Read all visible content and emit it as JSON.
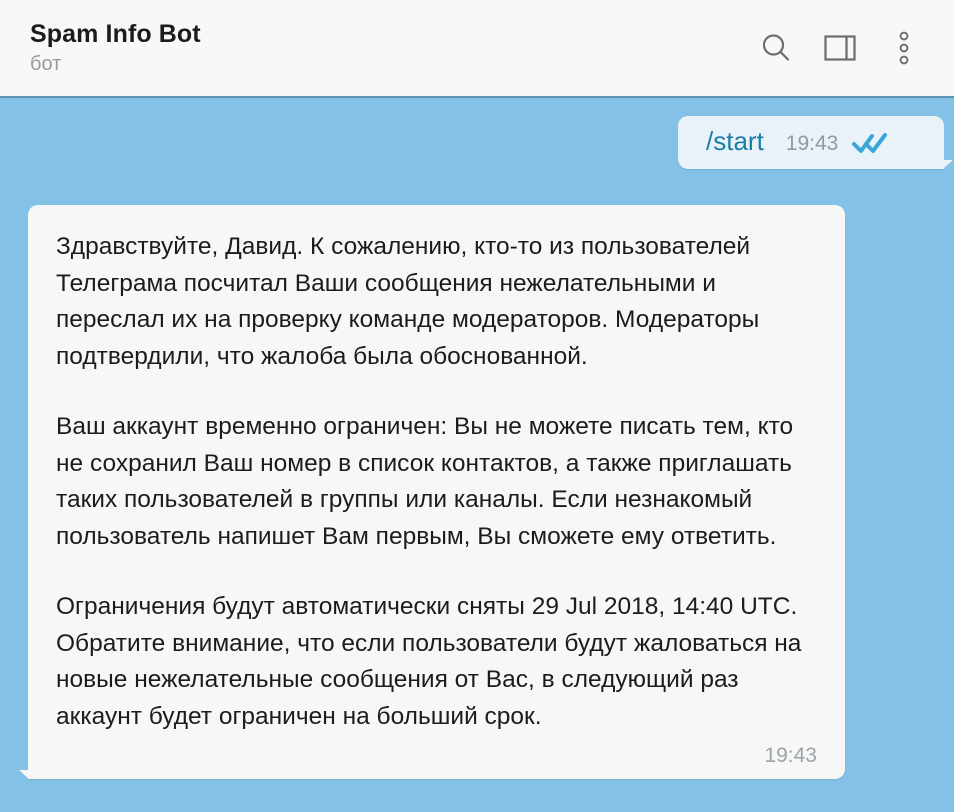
{
  "header": {
    "title": "Spam Info Bot",
    "subtitle": "бот",
    "actions": [
      {
        "name": "search-icon",
        "label": "Search"
      },
      {
        "name": "panel-toggle-icon",
        "label": "Toggle info panel"
      },
      {
        "name": "more-menu-icon",
        "label": "More options"
      }
    ]
  },
  "colors": {
    "chat_background": "#84c1e6",
    "header_background": "#f9f8f7",
    "incoming_bubble": "#f8f7f7",
    "outgoing_bubble": "#e8f2f8",
    "command_link": "#1c7da6",
    "tick_blue": "#3aa6db",
    "timestamp_gray": "#9aa3a8",
    "body_text": "#1c1c1c",
    "subtitle_gray": "#9a9a9a"
  },
  "messages": {
    "outgoing": {
      "text": "/start",
      "time": "19:43",
      "status": "read"
    },
    "incoming": {
      "paragraphs": [
        "Здравствуйте, Давид. К сожалению, кто-то из пользователей Телеграма посчитал Ваши сообщения нежелательными и переслал их на проверку команде модераторов. Модераторы подтвердили, что жалоба была обоснованной.",
        "Ваш аккаунт временно ограничен: Вы не можете писать тем, кто не сохранил Ваш номер в список контактов, а также приглашать таких пользователей в группы или каналы. Если незнакомый пользователь напишет Вам первым, Вы сможете ему ответить.",
        "Ограничения будут автоматически сняты 29 Jul 2018, 14:40 UTC. Обратите внимание, что если пользователи будут жаловаться на новые нежелательные сообщения от Вас, в следующий раз аккаунт будет ограничен на больший срок."
      ],
      "time": "19:43"
    }
  }
}
